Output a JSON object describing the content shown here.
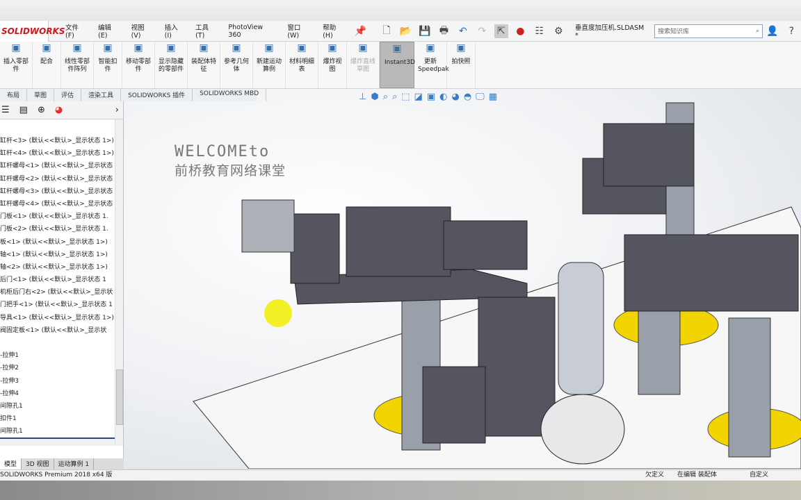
{
  "app": {
    "logo": "SOLIDWORKS",
    "document_title": "垂直度加压机.SLDASM *"
  },
  "menu": [
    "文件(F)",
    "编辑(E)",
    "视图(V)",
    "插入(I)",
    "工具(T)",
    "PhotoView 360",
    "窗口(W)",
    "帮助(H)"
  ],
  "search": {
    "placeholder": "搜索知识库"
  },
  "command_manager": [
    {
      "label": "插入零部件",
      "icon": "insert-component-icon"
    },
    {
      "label": "配合",
      "icon": "mate-icon"
    },
    {
      "label": "线性零部件阵列",
      "icon": "pattern-icon"
    },
    {
      "label": "智能扣件",
      "icon": "smart-fastener-icon"
    },
    {
      "label": "移动零部件",
      "icon": "move-component-icon"
    },
    {
      "label": "显示隐藏的零部件",
      "icon": "show-hidden-icon"
    },
    {
      "label": "装配体特征",
      "icon": "assembly-feature-icon"
    },
    {
      "label": "参考几何体",
      "icon": "reference-geometry-icon"
    },
    {
      "label": "新建运动算例",
      "icon": "motion-study-icon"
    },
    {
      "label": "材料明细表",
      "icon": "bom-icon"
    },
    {
      "label": "爆炸视图",
      "icon": "exploded-view-icon"
    },
    {
      "label": "爆炸直线草图",
      "icon": "explode-line-icon",
      "disabled": true
    },
    {
      "label": "Instant3D",
      "icon": "instant3d-icon",
      "active": true
    },
    {
      "label": "更新Speedpak",
      "icon": "speedpak-icon"
    },
    {
      "label": "拍快照",
      "icon": "camera-icon"
    }
  ],
  "tabs": [
    "布局",
    "草图",
    "评估",
    "渲染工具",
    "SOLIDWORKS 插件",
    "SOLIDWORKS MBD"
  ],
  "tree": [
    "缸杆<3> (默认<<默认>_显示状态 1>)",
    "缸杆<4> (默认<<默认>_显示状态 1>)",
    "缸杆螺母<1> (默认<<默认>_显示状态",
    "缸杆螺母<2> (默认<<默认>_显示状态",
    "缸杆螺母<3> (默认<<默认>_显示状态",
    "缸杆螺母<4> (默认<<默认>_显示状态",
    "门板<1> (默认<<默认>_显示状态 1.",
    "门板<2> (默认<<默认>_显示状态 1.",
    "板<1> (默认<<默认>_显示状态 1>)",
    "轴<1> (默认<<默认>_显示状态 1>)",
    "轴<2> (默认<<默认>_显示状态 1>)",
    "后门<1> (默认<<默认>_显示状态 1",
    "机柜后门右<2> (默认<<默认>_显示状",
    "门把手<1> (默认<<默认>_显示状态 1",
    "导具<1> (默认<<默认>_显示状态 1>)",
    "阀固定板<1> (默认<<默认>_显示状",
    "",
    "-拉伸1",
    "-拉伸2",
    "-拉伸3",
    "-拉伸4",
    "间隙孔1",
    "扣件1",
    "间隙孔1"
  ],
  "bottom_tabs": [
    "模型",
    "3D 视图",
    "运动算例 1"
  ],
  "watermark": {
    "line1": "WELCOMEto",
    "line2": "前桥教育网络课堂"
  },
  "status": {
    "left": "SOLIDWORKS Premium 2018 x64 版",
    "s1": "欠定义",
    "s2": "在编辑 装配体",
    "s3": "自定义"
  },
  "colors": {
    "accent": "#d0161b",
    "flange": "#f2d400",
    "metal": "#5a5a66"
  }
}
